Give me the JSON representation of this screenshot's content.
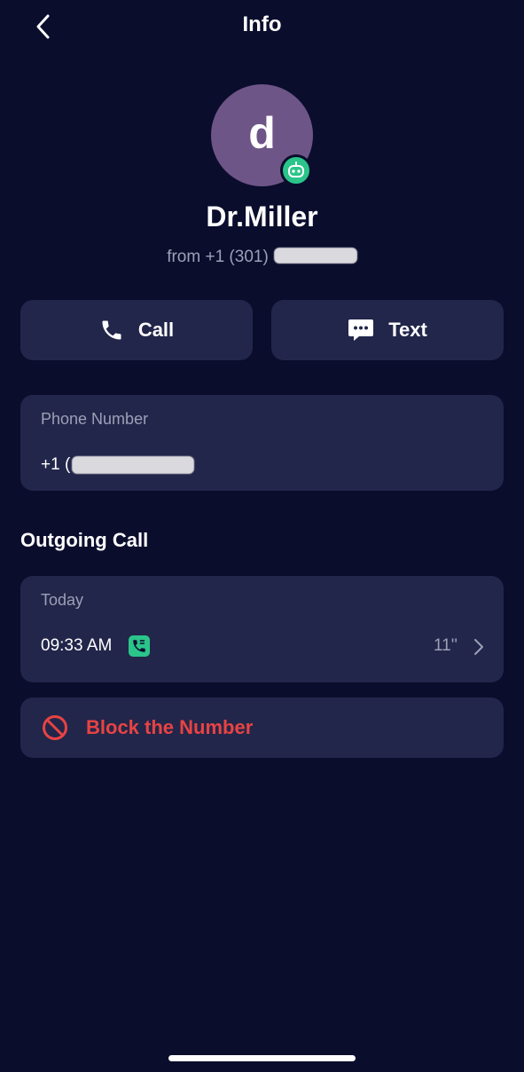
{
  "header": {
    "title": "Info"
  },
  "contact": {
    "avatar_letter": "d",
    "name": "Dr.Miller",
    "from_prefix": "from +1 (301)"
  },
  "actions": {
    "call_label": "Call",
    "text_label": "Text"
  },
  "phone": {
    "label": "Phone Number",
    "value_prefix": "+1 ("
  },
  "history": {
    "section_title": "Outgoing Call",
    "day": "Today",
    "entries": [
      {
        "time": "09:33 AM",
        "duration": "11''"
      }
    ]
  },
  "block": {
    "label": "Block the Number"
  },
  "colors": {
    "background": "#0a0d2c",
    "card": "#22264a",
    "accent_green": "#2bc48a",
    "danger_red": "#e84343",
    "avatar": "#6e5588"
  }
}
